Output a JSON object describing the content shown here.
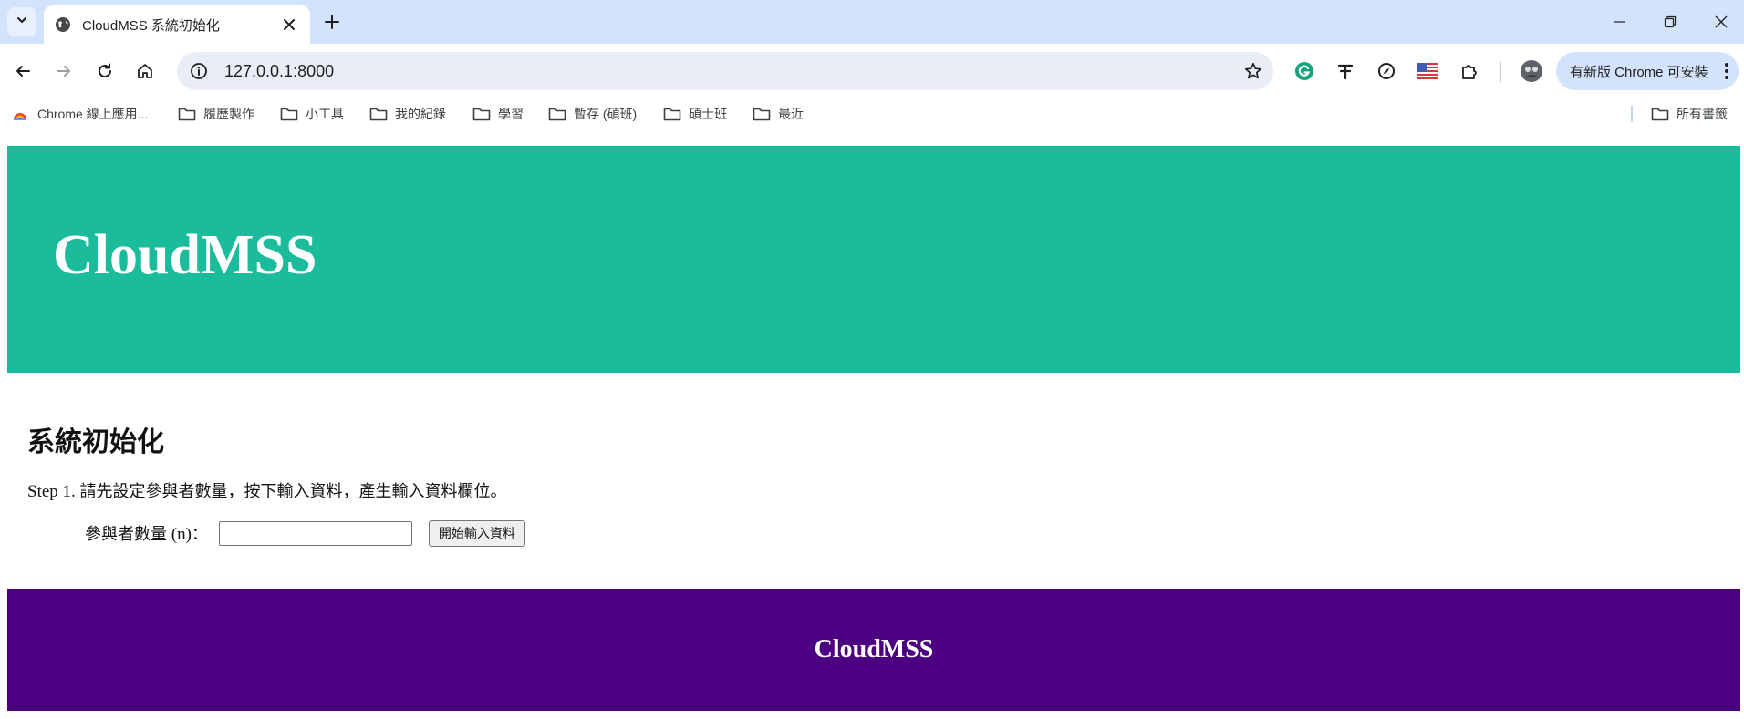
{
  "browser": {
    "tab": {
      "title": "CloudMSS 系統初始化"
    },
    "omnibox": {
      "url": "127.0.0.1:8000"
    },
    "update_button": {
      "label": "有新版 Chrome 可安裝"
    },
    "bookmarks": [
      {
        "label": "Chrome 線上應用...",
        "icon": "chrome-webstore-icon"
      },
      {
        "label": "履歷製作",
        "icon": "folder-icon"
      },
      {
        "label": "小工具",
        "icon": "folder-icon"
      },
      {
        "label": "我的紀錄",
        "icon": "folder-icon"
      },
      {
        "label": "學習",
        "icon": "folder-icon"
      },
      {
        "label": "暫存 (碩班)",
        "icon": "folder-icon"
      },
      {
        "label": "碩士班",
        "icon": "folder-icon"
      },
      {
        "label": "最近",
        "icon": "folder-icon"
      }
    ],
    "all_bookmarks": {
      "label": "所有書籤"
    },
    "colors": {
      "tabstrip": "#d3e3fd",
      "omnibox": "#e9eef6"
    }
  },
  "page": {
    "header": {
      "title": "CloudMSS",
      "color": "#1abc9c"
    },
    "title": "系統初始化",
    "step1": {
      "prefix": "Step 1. ",
      "text": "請先設定參與者數量，按下輸入資料，產生輸入資料欄位。"
    },
    "form": {
      "label_cjk": "參與者數量",
      "label_var": " (n)",
      "label_colon": "：",
      "input_value": "",
      "button_label": "開始輸入資料"
    },
    "footer": {
      "title": "CloudMSS",
      "color": "#4b0082"
    }
  }
}
